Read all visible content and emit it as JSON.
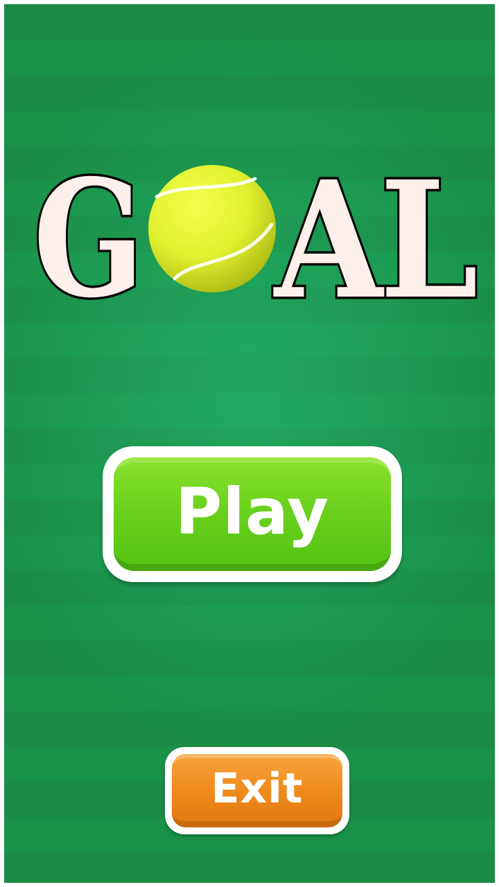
{
  "title": {
    "text": "GOAL",
    "letters": [
      "G",
      "A",
      "L"
    ],
    "ball_replaces": "O"
  },
  "buttons": {
    "play_label": "Play",
    "exit_label": "Exit"
  },
  "colors": {
    "background_green": "#1b8b45",
    "title_fill": "#fdf0ea",
    "title_outline": "#000000",
    "play_button": "#6bd11e",
    "exit_button": "#ef8a1c",
    "ball": "#e6f53a"
  },
  "icons": {
    "ball": "tennis-ball-icon"
  }
}
